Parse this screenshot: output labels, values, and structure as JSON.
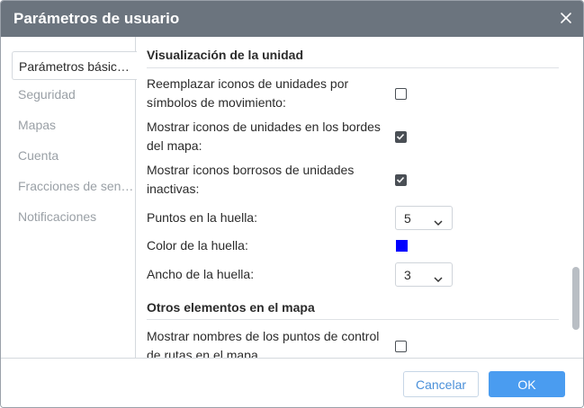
{
  "dialog": {
    "title": "Parámetros de usuario",
    "close_icon": "close-icon"
  },
  "sidebar": {
    "items": [
      {
        "label": "Parámetros básic…",
        "active": true
      },
      {
        "label": "Seguridad",
        "active": false
      },
      {
        "label": "Mapas",
        "active": false
      },
      {
        "label": "Cuenta",
        "active": false
      },
      {
        "label": "Fracciones de sen…",
        "active": false
      },
      {
        "label": "Notificaciones",
        "active": false
      }
    ]
  },
  "content": {
    "section_unit_display": {
      "title": "Visualización de la unidad",
      "replace_icons": {
        "label": "Reemplazar iconos de unidades por símbolos de movimiento:",
        "checked": false
      },
      "show_icons_edges": {
        "label": "Mostrar iconos de unidades en los bordes del mapa:",
        "checked": true
      },
      "blurred_icons": {
        "label": "Mostrar iconos borrosos de unidades inactivas:",
        "checked": true
      },
      "track_points": {
        "label": "Puntos en la huella:",
        "value": "5"
      },
      "track_color": {
        "label": "Color de la huella:",
        "color": "#0000ff"
      },
      "track_width": {
        "label": "Ancho de la huella:",
        "value": "3"
      }
    },
    "section_other": {
      "title": "Otros elementos en el mapa",
      "route_checkpoints": {
        "label": "Mostrar nombres de los puntos de control de rutas en el mapa",
        "checked": false
      }
    }
  },
  "footer": {
    "cancel_label": "Cancelar",
    "ok_label": "OK"
  },
  "colors": {
    "titlebar": "#6b747e",
    "accent": "#4a9cf0"
  }
}
